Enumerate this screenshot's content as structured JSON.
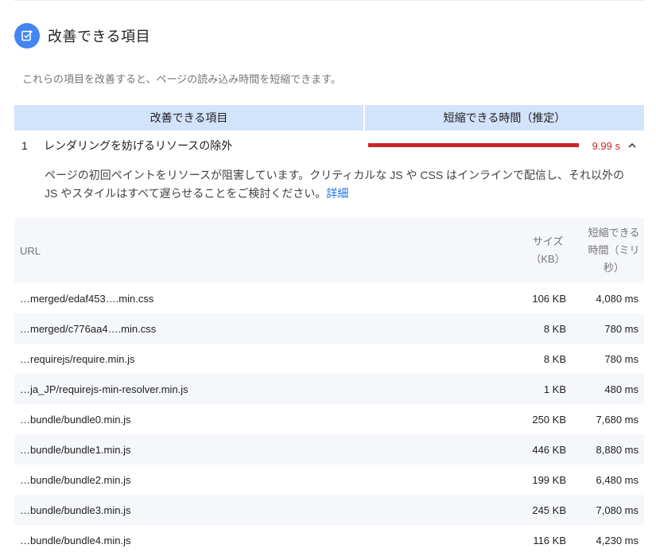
{
  "section": {
    "title": "改善できる項目",
    "icon": "opportunity-icon",
    "accent_color": "#4285f4",
    "description": "これらの項目を改善すると、ページの読み込み時間を短縮できます。"
  },
  "table_header": {
    "left": "改善できる項目",
    "right": "短縮できる時間（推定）"
  },
  "audit": {
    "index": "1",
    "title": "レンダリングを妨げるリソースの除外",
    "savings": "9.99 s",
    "savings_bar_fraction": 1.0,
    "bar_color": "#c62828",
    "description": "ページの初回ペイントをリソースが阻害しています。クリティカルな JS や CSS はインラインで配信し、それ以外の JS やスタイルはすべて遅らせることをご検討ください。",
    "link_label": "詳細"
  },
  "details": {
    "headers": {
      "url": "URL",
      "size_line1": "サイズ",
      "size_line2": "（KB）",
      "time_line1": "短縮できる",
      "time_line2": "時間（ミリ",
      "time_line3": "秒）"
    },
    "rows": [
      {
        "url": "…merged/edaf453….min.css",
        "size": "106 KB",
        "time": "4,080 ms"
      },
      {
        "url": "…merged/c776aa4….min.css",
        "size": "8 KB",
        "time": "780 ms"
      },
      {
        "url": "…requirejs/require.min.js",
        "size": "8 KB",
        "time": "780 ms"
      },
      {
        "url": "…ja_JP/requirejs-min-resolver.min.js",
        "size": "1 KB",
        "time": "480 ms"
      },
      {
        "url": "…bundle/bundle0.min.js",
        "size": "250 KB",
        "time": "7,680 ms"
      },
      {
        "url": "…bundle/bundle1.min.js",
        "size": "446 KB",
        "time": "8,880 ms"
      },
      {
        "url": "…bundle/bundle2.min.js",
        "size": "199 KB",
        "time": "6,480 ms"
      },
      {
        "url": "…bundle/bundle3.min.js",
        "size": "245 KB",
        "time": "7,080 ms"
      },
      {
        "url": "…bundle/bundle4.min.js",
        "size": "116 KB",
        "time": "4,230 ms"
      }
    ]
  }
}
